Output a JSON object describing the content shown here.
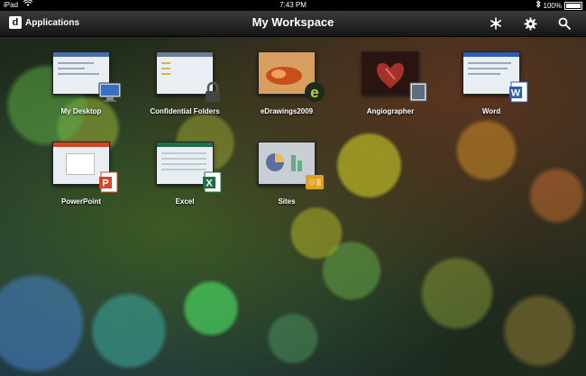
{
  "statusbar": {
    "device": "iPad",
    "time": "7:43 PM",
    "battery": "100%"
  },
  "navbar": {
    "apps_label": "Applications",
    "apps_logo_letter": "d",
    "title": "My Workspace",
    "icons": [
      "snowflake-icon",
      "gear-icon",
      "search-icon"
    ]
  },
  "apps": [
    {
      "label": "My Desktop"
    },
    {
      "label": "Confidential Folders"
    },
    {
      "label": "eDrawings2009",
      "badge_letter": "e"
    },
    {
      "label": "Angiographer"
    },
    {
      "label": "Word",
      "badge_letter": "W"
    },
    {
      "label": "PowerPoint",
      "badge_letter": "P"
    },
    {
      "label": "Excel",
      "badge_letter": "X"
    },
    {
      "label": "Sites"
    }
  ],
  "colors": {
    "word": "#2b5fb4",
    "powerpoint": "#d24726",
    "excel": "#1e7145",
    "edrawings": "#c8d22a"
  }
}
